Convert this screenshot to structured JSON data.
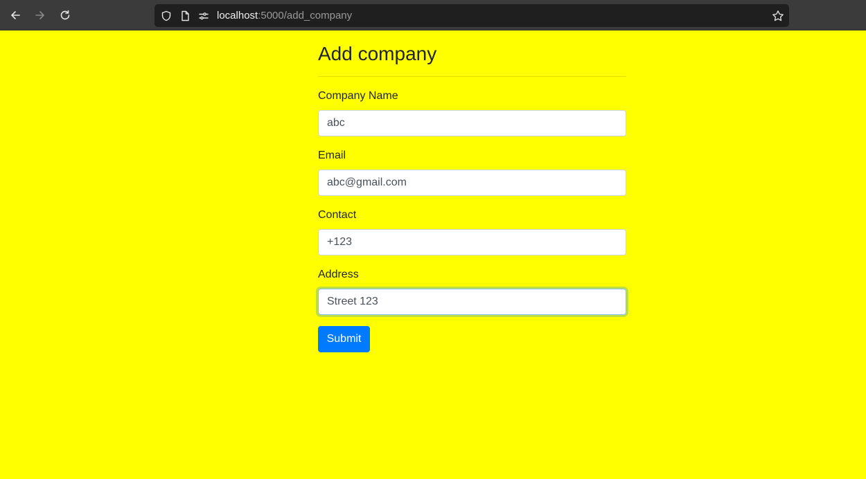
{
  "browser": {
    "url_host": "localhost",
    "url_path": ":5000/add_company",
    "icons": [
      "back-arrow-icon",
      "forward-arrow-icon",
      "reload-icon",
      "shield-icon",
      "page-icon",
      "permissions-icon",
      "bookmark-star-icon"
    ]
  },
  "page": {
    "background": "#ffff00",
    "title": "Add company",
    "fields": [
      {
        "label": "Company Name",
        "value": "abc"
      },
      {
        "label": "Email",
        "value": "abc@gmail.com"
      },
      {
        "label": "Contact",
        "value": "+123"
      },
      {
        "label": "Address",
        "value": "Street 123",
        "focused": true
      }
    ],
    "submit_label": "Submit",
    "accent": "#007bff"
  }
}
